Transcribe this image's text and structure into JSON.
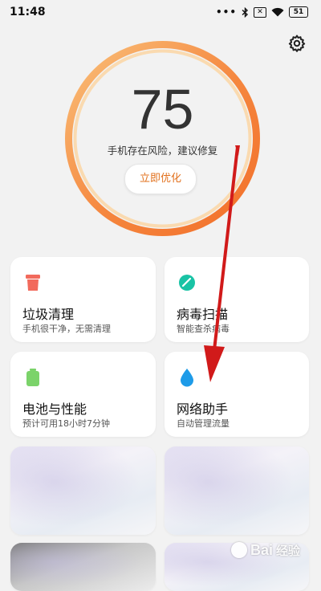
{
  "status_bar": {
    "time": "11:48",
    "dots": "•••",
    "battery_level": "51"
  },
  "score": {
    "value": "75",
    "message": "手机存在风险，建议修复",
    "button_label": "立即优化"
  },
  "cards": {
    "junk": {
      "title": "垃圾清理",
      "subtitle": "手机很干净，无需清理",
      "icon": "trash-icon",
      "icon_color": "#f26a5c"
    },
    "virus": {
      "title": "病毒扫描",
      "subtitle": "智能查杀病毒",
      "icon": "shield-scan-icon",
      "icon_color": "#19c3a5"
    },
    "battery": {
      "title": "电池与性能",
      "subtitle": "预计可用18小时7分钟",
      "icon": "battery-icon",
      "icon_color": "#7bd36a"
    },
    "network": {
      "title": "网络助手",
      "subtitle": "自动管理流量",
      "icon": "water-drop-icon",
      "icon_color": "#1e9be8"
    }
  },
  "colors": {
    "ring_outer": "#f57a38",
    "ring_inner": "#f8c98a",
    "accent": "#e2711d",
    "annotation_arrow": "#d11a1a"
  },
  "watermark": {
    "brand": "Bai",
    "brand_suffix": "经验",
    "paw_icon": "paw-icon"
  }
}
